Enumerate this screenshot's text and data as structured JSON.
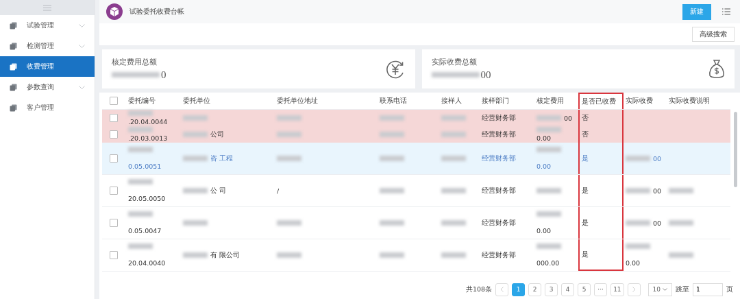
{
  "sidebar": {
    "items": [
      {
        "label": "试验管理",
        "selected": false,
        "expandable": true
      },
      {
        "label": "检测管理",
        "selected": false,
        "expandable": true
      },
      {
        "label": "收费管理",
        "selected": true,
        "expandable": false
      },
      {
        "label": "参数查询",
        "selected": false,
        "expandable": true
      },
      {
        "label": "客户管理",
        "selected": false,
        "expandable": false
      }
    ]
  },
  "header": {
    "title": "试验委托收费台帐",
    "new_button": "新建"
  },
  "toolbar": {
    "advanced_search": "高级搜索"
  },
  "summary_cards": [
    {
      "kind": "yen",
      "label": "核定费用总额",
      "value": "0"
    },
    {
      "kind": "bag",
      "label": "实际收费总额",
      "value": "00"
    }
  ],
  "table": {
    "select_all": {
      "checked": false
    },
    "columns": [
      {
        "label": "委托编号",
        "outlined": false
      },
      {
        "label": "委托单位",
        "outlined": false
      },
      {
        "label": "委托单位地址",
        "outlined": false
      },
      {
        "label": "联系电话",
        "outlined": false
      },
      {
        "label": "接样人",
        "outlined": false
      },
      {
        "label": "接样部门",
        "outlined": false
      },
      {
        "label": "核定费用",
        "outlined": false
      },
      {
        "label": "是否已收费",
        "outlined": true
      },
      {
        "label": "实际收费",
        "outlined": false
      },
      {
        "label": "实际收费说明",
        "outlined": false
      }
    ],
    "rows": [
      {
        "overdue": true,
        "selected": false,
        "checked": false,
        "cells": [
          {
            "kind": "blurred_text",
            "text": ".20.04.0044"
          },
          {
            "kind": "blurred"
          },
          {
            "kind": "blurred"
          },
          {
            "kind": "blurred"
          },
          {
            "kind": "blurred"
          },
          {
            "kind": "text",
            "text": "经营财务部"
          },
          {
            "kind": "blurred_text",
            "text": "00"
          },
          {
            "kind": "text",
            "text": "否"
          },
          {
            "kind": "empty"
          },
          {
            "kind": "empty"
          }
        ]
      },
      {
        "overdue": true,
        "selected": false,
        "checked": false,
        "cells": [
          {
            "kind": "blurred_text",
            "text": ".20.03.0013"
          },
          {
            "kind": "blurred_text",
            "text": "公司"
          },
          {
            "kind": "blurred"
          },
          {
            "kind": "blurred"
          },
          {
            "kind": "blurred"
          },
          {
            "kind": "text",
            "text": "经营财务部"
          },
          {
            "kind": "blurred_text",
            "text": "0.00"
          },
          {
            "kind": "text",
            "text": "否"
          },
          {
            "kind": "empty"
          },
          {
            "kind": "empty"
          }
        ]
      },
      {
        "overdue": false,
        "selected": true,
        "checked": false,
        "cells": [
          {
            "kind": "blurred_text",
            "text": "0.05.0051"
          },
          {
            "kind": "blurred_text",
            "text": "咨 工程"
          },
          {
            "kind": "blurred"
          },
          {
            "kind": "blurred"
          },
          {
            "kind": "blurred"
          },
          {
            "kind": "text",
            "text": "经营财务部"
          },
          {
            "kind": "blurred_text",
            "text": "0.00"
          },
          {
            "kind": "text",
            "text": "是"
          },
          {
            "kind": "blurred_text",
            "text": "00"
          },
          {
            "kind": "empty"
          }
        ]
      },
      {
        "overdue": false,
        "selected": false,
        "checked": false,
        "cells": [
          {
            "kind": "blurred_text",
            "text": "20.05.0050"
          },
          {
            "kind": "blurred_text",
            "text": "公 司"
          },
          {
            "kind": "text",
            "text": "/"
          },
          {
            "kind": "blurred"
          },
          {
            "kind": "blurred"
          },
          {
            "kind": "text",
            "text": "经营财务部"
          },
          {
            "kind": "blurred"
          },
          {
            "kind": "text",
            "text": "是"
          },
          {
            "kind": "blurred_text",
            "text": "00"
          },
          {
            "kind": "blurred"
          }
        ]
      },
      {
        "overdue": false,
        "selected": false,
        "checked": false,
        "cells": [
          {
            "kind": "blurred_text",
            "text": "0.05.0047"
          },
          {
            "kind": "blurred"
          },
          {
            "kind": "blurred"
          },
          {
            "kind": "blurred"
          },
          {
            "kind": "blurred"
          },
          {
            "kind": "text",
            "text": "经营财务部"
          },
          {
            "kind": "blurred_text",
            "text": "0.00"
          },
          {
            "kind": "text",
            "text": "是"
          },
          {
            "kind": "blurred_text",
            "text": "00"
          },
          {
            "kind": "blurred"
          }
        ]
      },
      {
        "overdue": false,
        "selected": false,
        "checked": false,
        "cells": [
          {
            "kind": "blurred_text",
            "text": "20.04.0040"
          },
          {
            "kind": "blurred_text",
            "text": "有 限公司"
          },
          {
            "kind": "blurred"
          },
          {
            "kind": "blurred"
          },
          {
            "kind": "blurred"
          },
          {
            "kind": "text",
            "text": "经营财务部"
          },
          {
            "kind": "blurred_text",
            "text": "000.00"
          },
          {
            "kind": "text",
            "text": "是"
          },
          {
            "kind": "blurred_text",
            "text": "0.00"
          },
          {
            "kind": "blurred"
          }
        ]
      }
    ]
  },
  "pagination": {
    "total": "共108条",
    "pages": [
      {
        "label": "1",
        "selected": true
      },
      {
        "label": "2",
        "selected": false
      },
      {
        "label": "3",
        "selected": false
      },
      {
        "label": "4",
        "selected": false
      },
      {
        "label": "5",
        "selected": false
      },
      {
        "label": "···",
        "selected": false
      },
      {
        "label": "11",
        "selected": false
      }
    ],
    "page_size": "10",
    "jump_label": "跳至",
    "jump_value": "1",
    "page_unit": "页"
  }
}
